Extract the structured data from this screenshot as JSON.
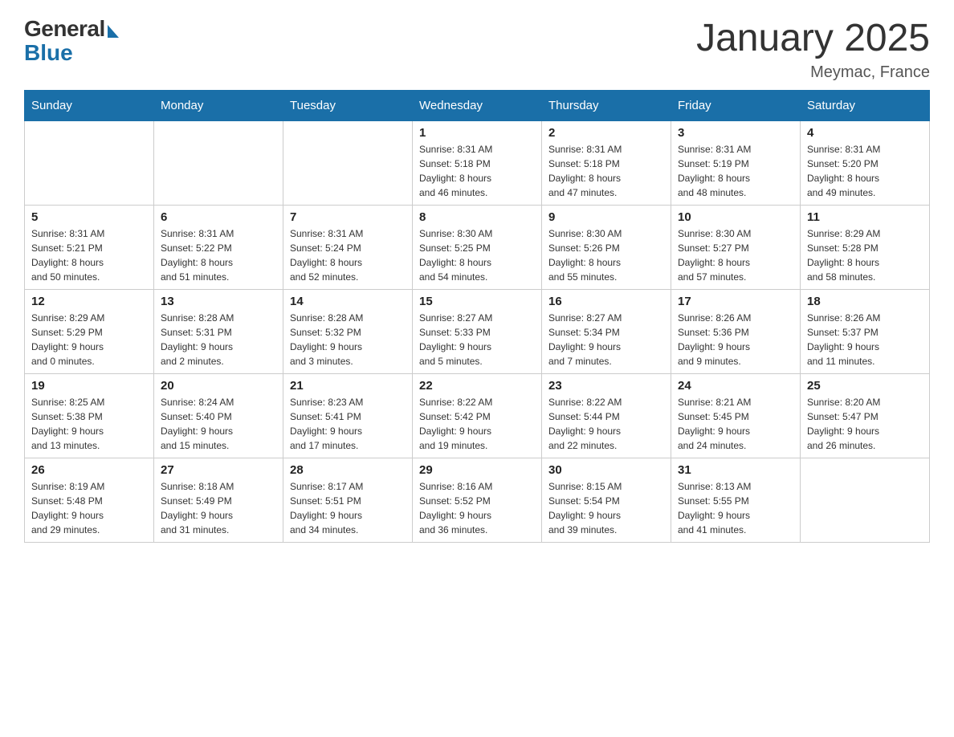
{
  "header": {
    "logo_general": "General",
    "logo_blue": "Blue",
    "title": "January 2025",
    "subtitle": "Meymac, France"
  },
  "weekdays": [
    "Sunday",
    "Monday",
    "Tuesday",
    "Wednesday",
    "Thursday",
    "Friday",
    "Saturday"
  ],
  "weeks": [
    [
      {
        "day": "",
        "info": ""
      },
      {
        "day": "",
        "info": ""
      },
      {
        "day": "",
        "info": ""
      },
      {
        "day": "1",
        "info": "Sunrise: 8:31 AM\nSunset: 5:18 PM\nDaylight: 8 hours\nand 46 minutes."
      },
      {
        "day": "2",
        "info": "Sunrise: 8:31 AM\nSunset: 5:18 PM\nDaylight: 8 hours\nand 47 minutes."
      },
      {
        "day": "3",
        "info": "Sunrise: 8:31 AM\nSunset: 5:19 PM\nDaylight: 8 hours\nand 48 minutes."
      },
      {
        "day": "4",
        "info": "Sunrise: 8:31 AM\nSunset: 5:20 PM\nDaylight: 8 hours\nand 49 minutes."
      }
    ],
    [
      {
        "day": "5",
        "info": "Sunrise: 8:31 AM\nSunset: 5:21 PM\nDaylight: 8 hours\nand 50 minutes."
      },
      {
        "day": "6",
        "info": "Sunrise: 8:31 AM\nSunset: 5:22 PM\nDaylight: 8 hours\nand 51 minutes."
      },
      {
        "day": "7",
        "info": "Sunrise: 8:31 AM\nSunset: 5:24 PM\nDaylight: 8 hours\nand 52 minutes."
      },
      {
        "day": "8",
        "info": "Sunrise: 8:30 AM\nSunset: 5:25 PM\nDaylight: 8 hours\nand 54 minutes."
      },
      {
        "day": "9",
        "info": "Sunrise: 8:30 AM\nSunset: 5:26 PM\nDaylight: 8 hours\nand 55 minutes."
      },
      {
        "day": "10",
        "info": "Sunrise: 8:30 AM\nSunset: 5:27 PM\nDaylight: 8 hours\nand 57 minutes."
      },
      {
        "day": "11",
        "info": "Sunrise: 8:29 AM\nSunset: 5:28 PM\nDaylight: 8 hours\nand 58 minutes."
      }
    ],
    [
      {
        "day": "12",
        "info": "Sunrise: 8:29 AM\nSunset: 5:29 PM\nDaylight: 9 hours\nand 0 minutes."
      },
      {
        "day": "13",
        "info": "Sunrise: 8:28 AM\nSunset: 5:31 PM\nDaylight: 9 hours\nand 2 minutes."
      },
      {
        "day": "14",
        "info": "Sunrise: 8:28 AM\nSunset: 5:32 PM\nDaylight: 9 hours\nand 3 minutes."
      },
      {
        "day": "15",
        "info": "Sunrise: 8:27 AM\nSunset: 5:33 PM\nDaylight: 9 hours\nand 5 minutes."
      },
      {
        "day": "16",
        "info": "Sunrise: 8:27 AM\nSunset: 5:34 PM\nDaylight: 9 hours\nand 7 minutes."
      },
      {
        "day": "17",
        "info": "Sunrise: 8:26 AM\nSunset: 5:36 PM\nDaylight: 9 hours\nand 9 minutes."
      },
      {
        "day": "18",
        "info": "Sunrise: 8:26 AM\nSunset: 5:37 PM\nDaylight: 9 hours\nand 11 minutes."
      }
    ],
    [
      {
        "day": "19",
        "info": "Sunrise: 8:25 AM\nSunset: 5:38 PM\nDaylight: 9 hours\nand 13 minutes."
      },
      {
        "day": "20",
        "info": "Sunrise: 8:24 AM\nSunset: 5:40 PM\nDaylight: 9 hours\nand 15 minutes."
      },
      {
        "day": "21",
        "info": "Sunrise: 8:23 AM\nSunset: 5:41 PM\nDaylight: 9 hours\nand 17 minutes."
      },
      {
        "day": "22",
        "info": "Sunrise: 8:22 AM\nSunset: 5:42 PM\nDaylight: 9 hours\nand 19 minutes."
      },
      {
        "day": "23",
        "info": "Sunrise: 8:22 AM\nSunset: 5:44 PM\nDaylight: 9 hours\nand 22 minutes."
      },
      {
        "day": "24",
        "info": "Sunrise: 8:21 AM\nSunset: 5:45 PM\nDaylight: 9 hours\nand 24 minutes."
      },
      {
        "day": "25",
        "info": "Sunrise: 8:20 AM\nSunset: 5:47 PM\nDaylight: 9 hours\nand 26 minutes."
      }
    ],
    [
      {
        "day": "26",
        "info": "Sunrise: 8:19 AM\nSunset: 5:48 PM\nDaylight: 9 hours\nand 29 minutes."
      },
      {
        "day": "27",
        "info": "Sunrise: 8:18 AM\nSunset: 5:49 PM\nDaylight: 9 hours\nand 31 minutes."
      },
      {
        "day": "28",
        "info": "Sunrise: 8:17 AM\nSunset: 5:51 PM\nDaylight: 9 hours\nand 34 minutes."
      },
      {
        "day": "29",
        "info": "Sunrise: 8:16 AM\nSunset: 5:52 PM\nDaylight: 9 hours\nand 36 minutes."
      },
      {
        "day": "30",
        "info": "Sunrise: 8:15 AM\nSunset: 5:54 PM\nDaylight: 9 hours\nand 39 minutes."
      },
      {
        "day": "31",
        "info": "Sunrise: 8:13 AM\nSunset: 5:55 PM\nDaylight: 9 hours\nand 41 minutes."
      },
      {
        "day": "",
        "info": ""
      }
    ]
  ]
}
